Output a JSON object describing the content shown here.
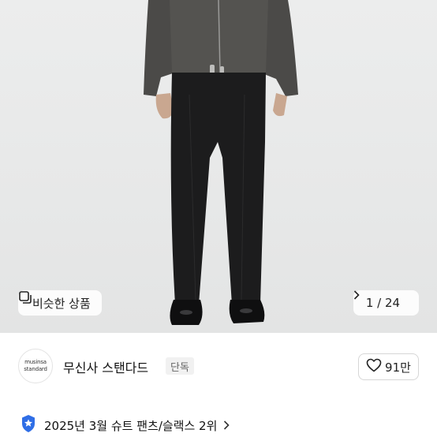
{
  "photo": {
    "similar_label": "비슷한 상품",
    "counter": "1 / 24",
    "icons": {
      "similar": "similar-items-icon",
      "next": "chevron-right-icon"
    }
  },
  "seller": {
    "logo_line1": "musinsa",
    "logo_line2": "standard",
    "name": "무신사 스탠다드",
    "badge": "단독",
    "likes": "91만",
    "icons": {
      "like": "heart-outline-icon"
    }
  },
  "ranking": {
    "text": "2025년 3월 슈트 팬츠/슬랙스 2위",
    "icons": {
      "badge": "ranking-star-badge-icon",
      "more": "chevron-right-icon"
    },
    "badge_color": "#2f6ee6"
  }
}
